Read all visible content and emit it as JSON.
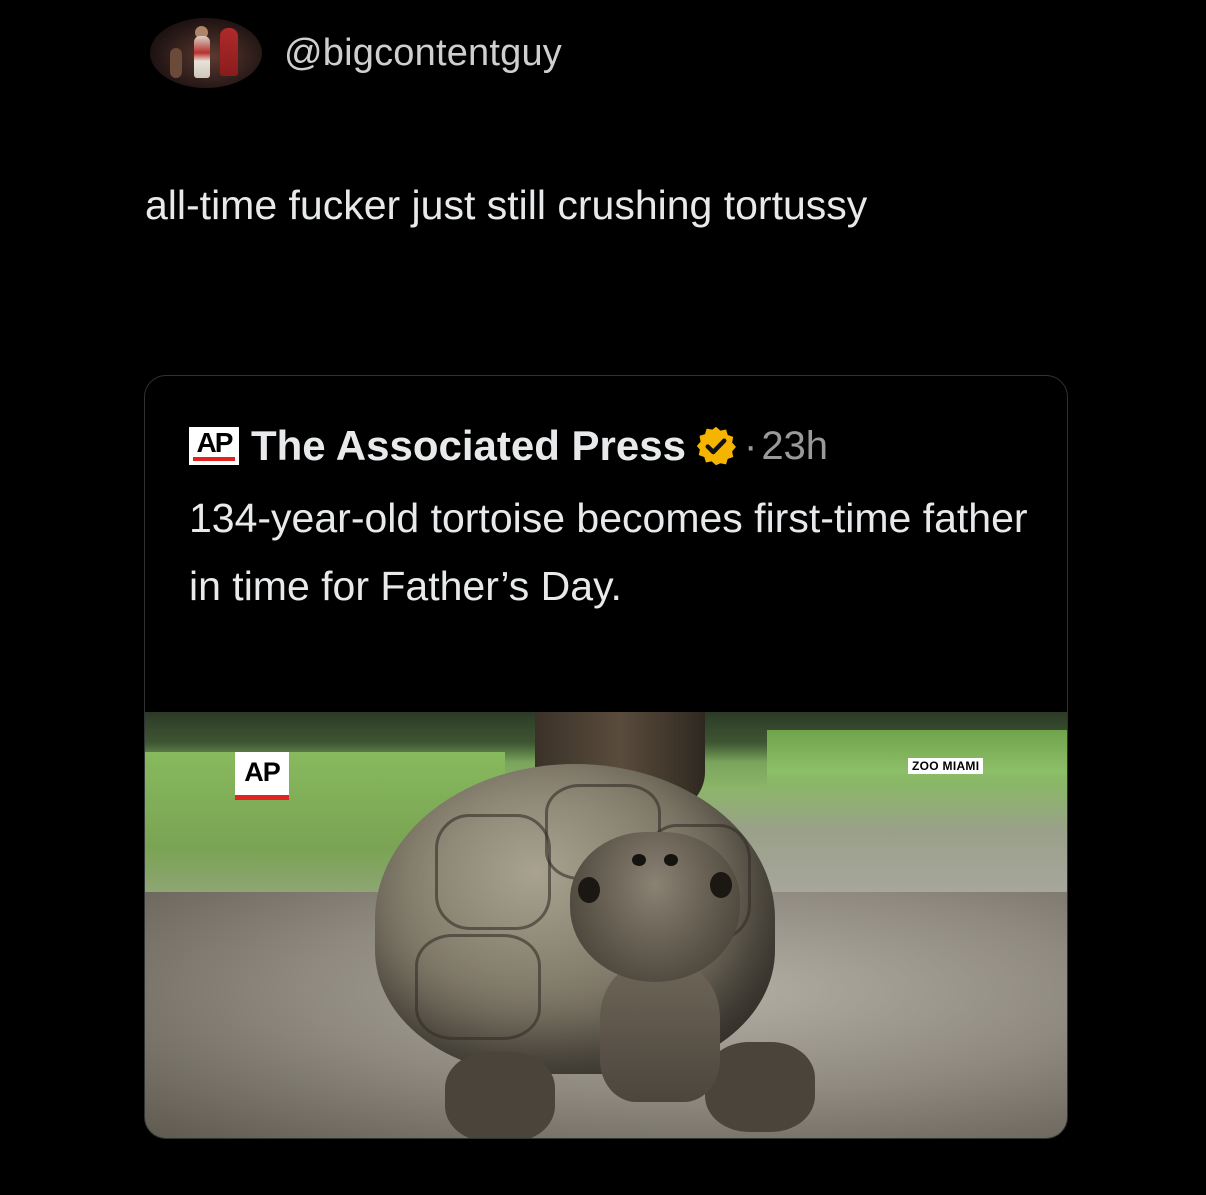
{
  "post": {
    "handle": "@bigcontentguy",
    "text": "all-time fucker just still crushing tortussy"
  },
  "quoted_post": {
    "logo_text": "AP",
    "source_name": "The Associated Press",
    "separator": "·",
    "timestamp": "23h",
    "text": "134-year-old tortoise becomes first-time father in time for Father’s Day.",
    "media": {
      "logo_text": "AP",
      "badge_text": "ZOO MIAMI"
    }
  },
  "colors": {
    "background": "#000000",
    "text": "#e7e9ea",
    "muted": "#9a9a9a",
    "verified": "#f4b400",
    "ap_red": "#e1241f",
    "card_border": "#2f3336"
  },
  "icons": {
    "verified": "verified-badge-icon",
    "logo": "ap-logo"
  }
}
